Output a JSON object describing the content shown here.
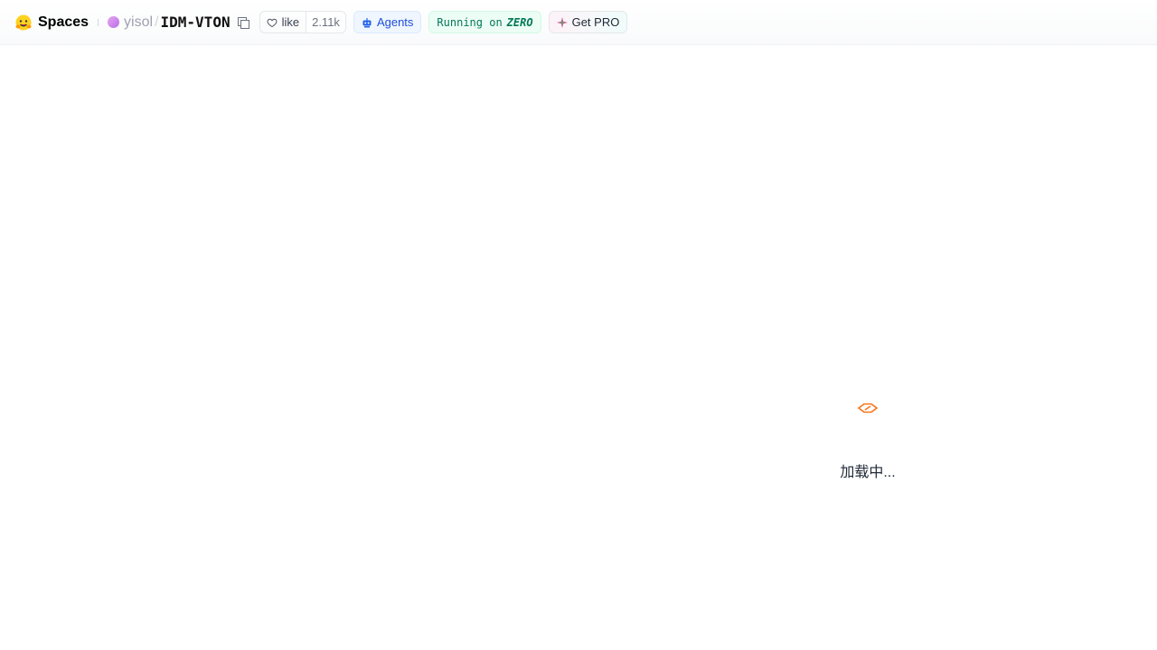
{
  "header": {
    "brand_label": "Spaces",
    "owner": "yisol",
    "separator": "/",
    "repo_name": "IDM-VTON",
    "like_label": "like",
    "like_count": "2.11k",
    "agents_label": "Agents",
    "running_label": "Running on",
    "running_hardware": "ZERO",
    "pro_label": "Get PRO"
  },
  "loading": {
    "text": "加载中..."
  },
  "colors": {
    "loader_accent": "#f97316",
    "agents": "#1d4ed8",
    "running": "#047857"
  }
}
